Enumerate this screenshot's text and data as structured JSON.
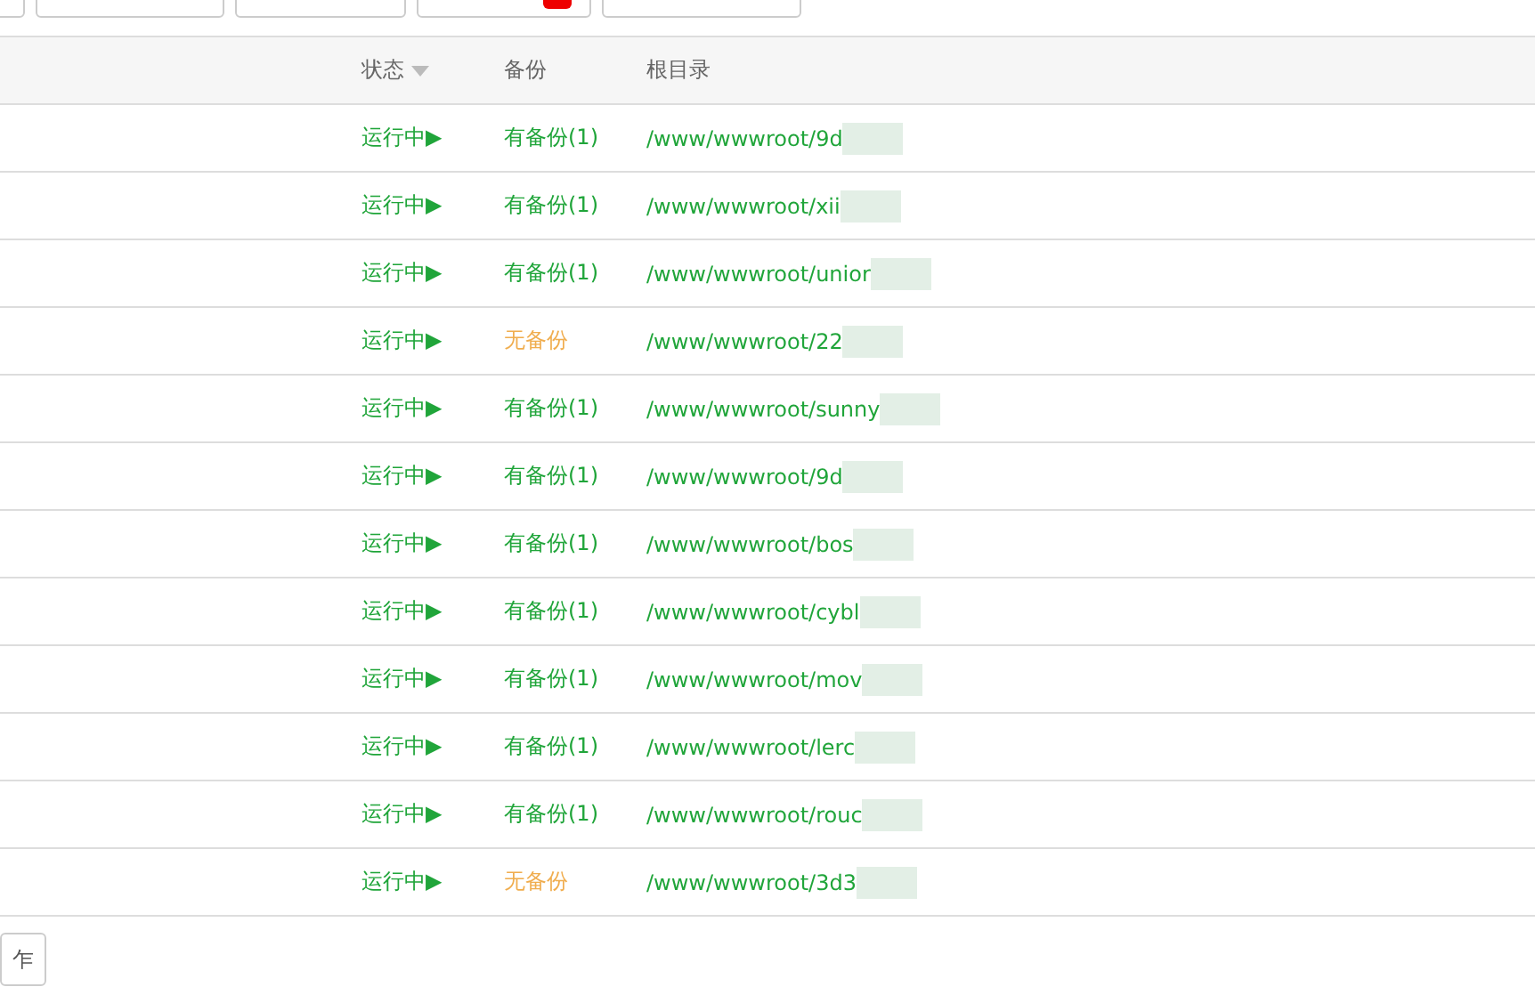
{
  "toolbar": {
    "buttons": [
      {
        "badge": false
      },
      {
        "badge": false
      },
      {
        "badge": false
      },
      {
        "badge": true
      },
      {
        "badge": false
      }
    ]
  },
  "table": {
    "columns": [
      "状态",
      "备份",
      "根目录"
    ],
    "rows": [
      {
        "status": "运行中▶",
        "backup": "有备份(1)",
        "has_backup": true,
        "path": "/www/wwwroot/9d"
      },
      {
        "status": "运行中▶",
        "backup": "有备份(1)",
        "has_backup": true,
        "path": "/www/wwwroot/xii"
      },
      {
        "status": "运行中▶",
        "backup": "有备份(1)",
        "has_backup": true,
        "path": "/www/wwwroot/unior"
      },
      {
        "status": "运行中▶",
        "backup": "无备份",
        "has_backup": false,
        "path": "/www/wwwroot/22"
      },
      {
        "status": "运行中▶",
        "backup": "有备份(1)",
        "has_backup": true,
        "path": "/www/wwwroot/sunny"
      },
      {
        "status": "运行中▶",
        "backup": "有备份(1)",
        "has_backup": true,
        "path": "/www/wwwroot/9d"
      },
      {
        "status": "运行中▶",
        "backup": "有备份(1)",
        "has_backup": true,
        "path": "/www/wwwroot/bos"
      },
      {
        "status": "运行中▶",
        "backup": "有备份(1)",
        "has_backup": true,
        "path": "/www/wwwroot/cybl"
      },
      {
        "status": "运行中▶",
        "backup": "有备份(1)",
        "has_backup": true,
        "path": "/www/wwwroot/mov"
      },
      {
        "status": "运行中▶",
        "backup": "有备份(1)",
        "has_backup": true,
        "path": "/www/wwwroot/lerc"
      },
      {
        "status": "运行中▶",
        "backup": "有备份(1)",
        "has_backup": true,
        "path": "/www/wwwroot/rouc"
      },
      {
        "status": "运行中▶",
        "backup": "无备份",
        "has_backup": false,
        "path": "/www/wwwroot/3d3"
      }
    ]
  },
  "footer": {
    "button": "乍"
  }
}
